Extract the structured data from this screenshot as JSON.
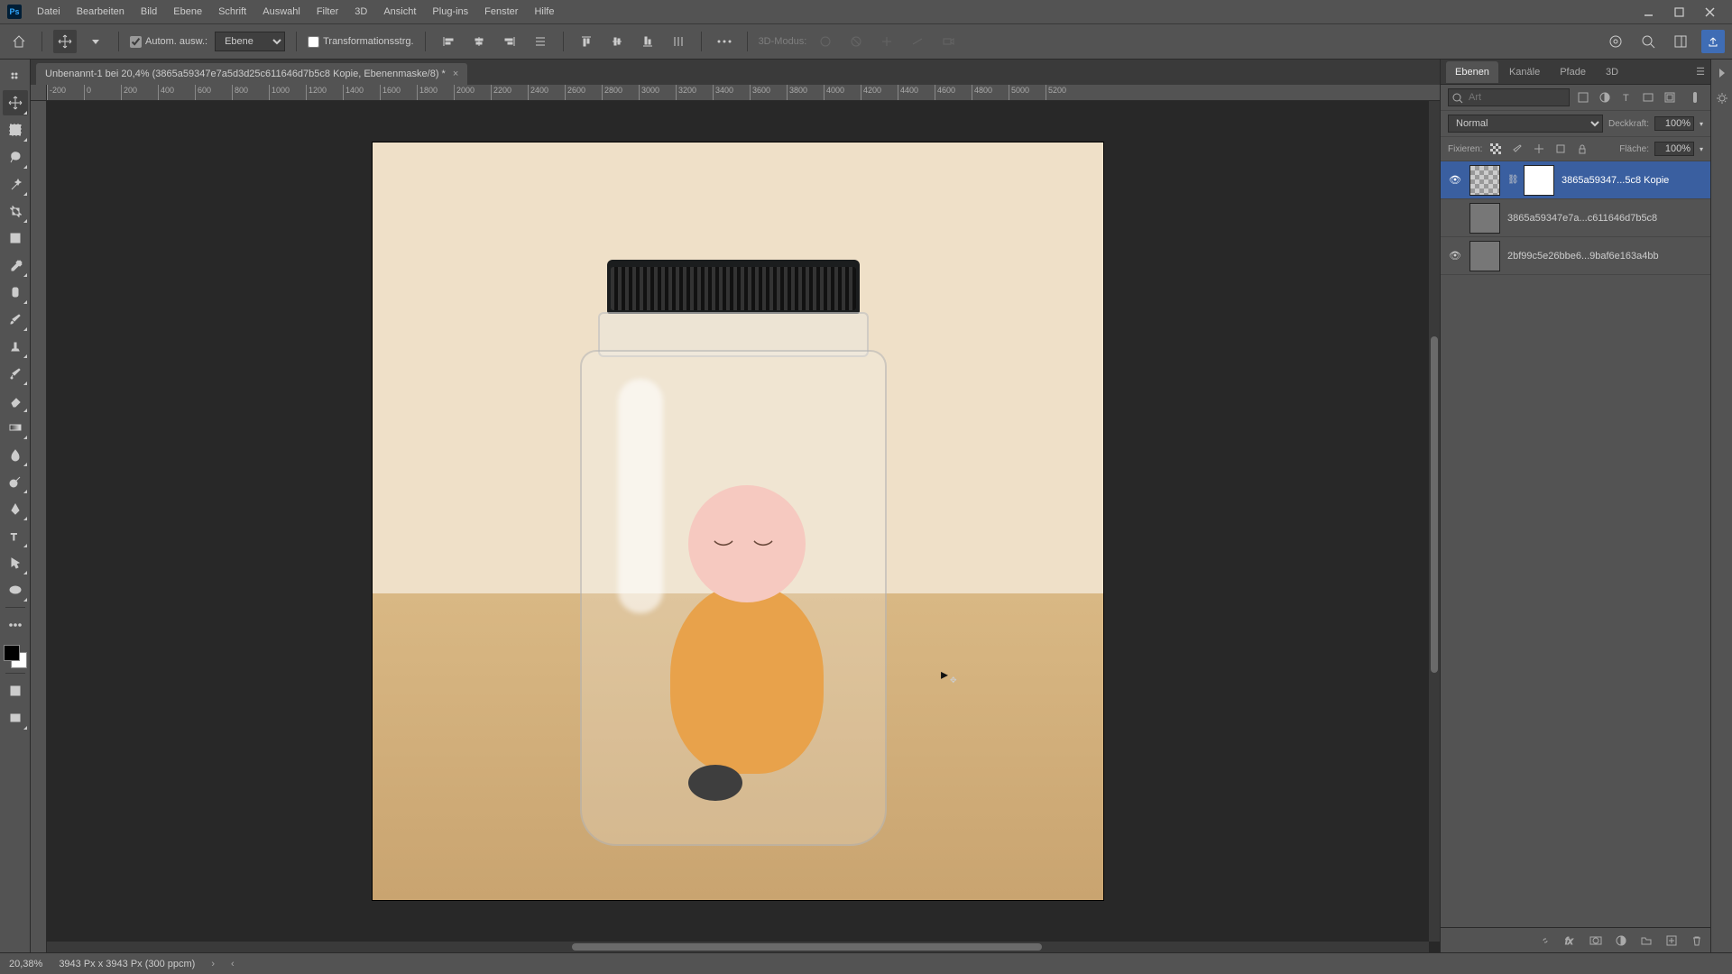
{
  "menu": {
    "items": [
      "Datei",
      "Bearbeiten",
      "Bild",
      "Ebene",
      "Schrift",
      "Auswahl",
      "Filter",
      "3D",
      "Ansicht",
      "Plug-ins",
      "Fenster",
      "Hilfe"
    ]
  },
  "options": {
    "auto_select_chk": true,
    "auto_select_label": "Autom. ausw.:",
    "auto_select_target": "Ebene",
    "transform_chk": false,
    "transform_label": "Transformationsstrg.",
    "mode3d_label": "3D-Modus:"
  },
  "document": {
    "tab_title": "Unbenannt-1 bei 20,4% (3865a59347e7a5d3d25c611646d7b5c8 Kopie, Ebenenmaske/8) *",
    "ruler_ticks": [
      "-200",
      "0",
      "200",
      "400",
      "600",
      "800",
      "1000",
      "1200",
      "1400",
      "1600",
      "1800",
      "2000",
      "2200",
      "2400",
      "2600",
      "2800",
      "3000",
      "3200",
      "3400",
      "3600",
      "3800",
      "4000",
      "4200",
      "4400",
      "4600",
      "4800",
      "5000",
      "5200"
    ]
  },
  "panels": {
    "tabs": {
      "layers": "Ebenen",
      "channels": "Kanäle",
      "paths": "Pfade",
      "threeD": "3D"
    },
    "search_placeholder": "Art",
    "blend_mode": "Normal",
    "opacity_label": "Deckkraft:",
    "opacity_value": "100%",
    "lock_label": "Fixieren:",
    "fill_label": "Fläche:",
    "fill_value": "100%",
    "layers": [
      {
        "visible": true,
        "name": "3865a59347...5c8 Kopie",
        "has_mask": true,
        "checker": true,
        "active": true
      },
      {
        "visible": false,
        "name": "3865a59347e7a...c611646d7b5c8",
        "has_mask": false,
        "checker": false,
        "active": false
      },
      {
        "visible": true,
        "name": "2bf99c5e26bbe6...9baf6e163a4bb",
        "has_mask": false,
        "checker": false,
        "active": false
      }
    ]
  },
  "status": {
    "zoom": "20,38%",
    "doc_info": "3943 Px x 3943 Px (300 ppcm)"
  }
}
